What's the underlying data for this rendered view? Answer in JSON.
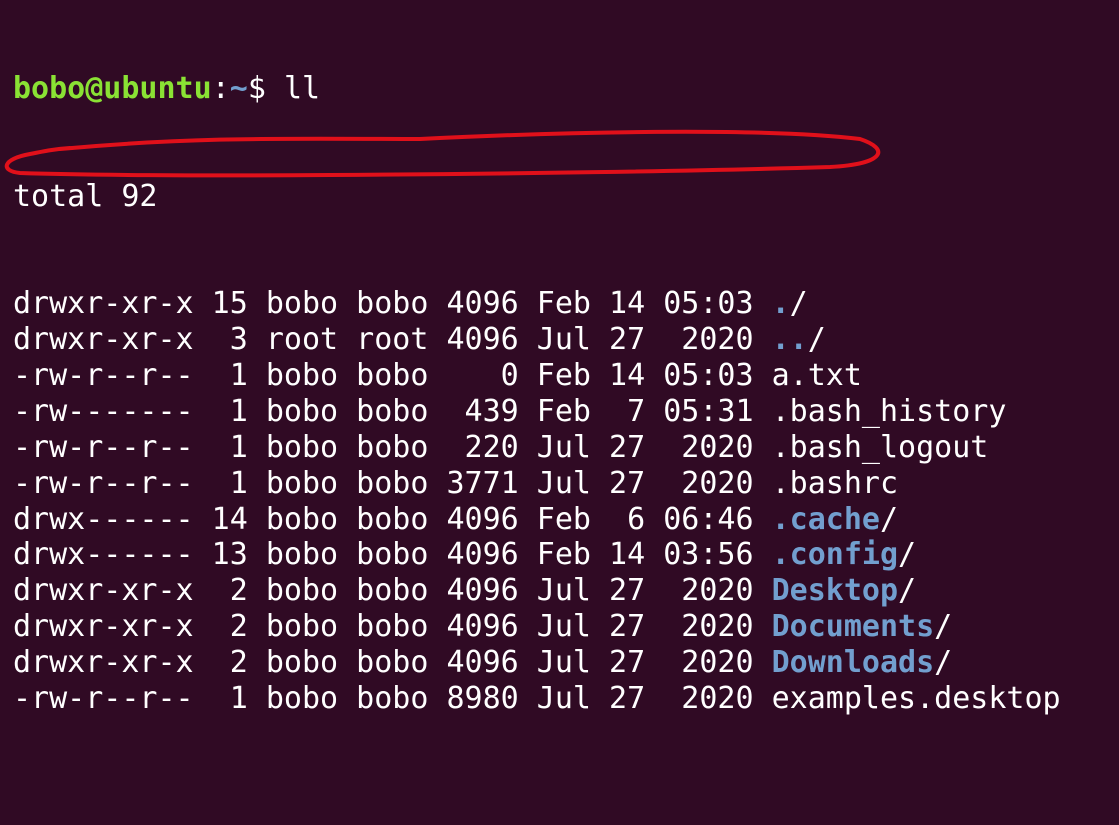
{
  "prompt": {
    "user_host": "bobo@ubuntu",
    "separator": ":",
    "path": "~",
    "symbol": "$ ",
    "command": "ll"
  },
  "total_line": "total 92",
  "entries": [
    {
      "meta": "drwxr-xr-x 15 bobo bobo 4096 Feb 14 05:03 ",
      "name_colored": ".",
      "name_plain": "/"
    },
    {
      "meta": "drwxr-xr-x  3 root root 4096 Jul 27  2020 ",
      "name_colored": "..",
      "name_plain": "/"
    },
    {
      "meta": "-rw-r--r--  1 bobo bobo    0 Feb 14 05:03 ",
      "name_colored": "",
      "name_plain": "a.txt"
    },
    {
      "meta": "-rw-------  1 bobo bobo  439 Feb  7 05:31 ",
      "name_colored": "",
      "name_plain": ".bash_history"
    },
    {
      "meta": "-rw-r--r--  1 bobo bobo  220 Jul 27  2020 ",
      "name_colored": "",
      "name_plain": ".bash_logout"
    },
    {
      "meta": "-rw-r--r--  1 bobo bobo 3771 Jul 27  2020 ",
      "name_colored": "",
      "name_plain": ".bashrc"
    },
    {
      "meta": "drwx------ 14 bobo bobo 4096 Feb  6 06:46 ",
      "name_colored": ".cache",
      "name_plain": "/"
    },
    {
      "meta": "drwx------ 13 bobo bobo 4096 Feb 14 03:56 ",
      "name_colored": ".config",
      "name_plain": "/"
    },
    {
      "meta": "drwxr-xr-x  2 bobo bobo 4096 Jul 27  2020 ",
      "name_colored": "Desktop",
      "name_plain": "/"
    },
    {
      "meta": "drwxr-xr-x  2 bobo bobo 4096 Jul 27  2020 ",
      "name_colored": "Documents",
      "name_plain": "/"
    },
    {
      "meta": "drwxr-xr-x  2 bobo bobo 4096 Jul 27  2020 ",
      "name_colored": "Downloads",
      "name_plain": "/"
    },
    {
      "meta": "-rw-r--r--  1 bobo bobo 8980 Jul 27  2020 ",
      "name_colored": "",
      "name_plain": "examples.desktop"
    }
  ],
  "colors": {
    "background": "#300a24",
    "text": "#ffffff",
    "user_host": "#8ae234",
    "directory": "#729fcf",
    "annotation": "#e0101a"
  }
}
